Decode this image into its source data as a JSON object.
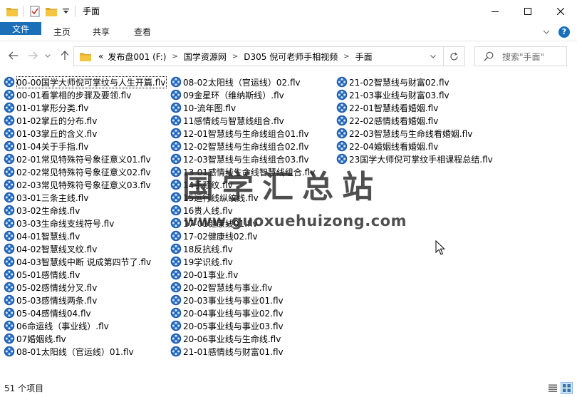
{
  "window": {
    "title": "手面",
    "minimize": "—",
    "maximize": "☐",
    "close": "✕"
  },
  "ribbon": {
    "tabs": [
      "文件",
      "主页",
      "共享",
      "查看"
    ]
  },
  "address": {
    "prefix": "«",
    "crumbs": [
      "发布盘001 (F:)",
      "国学资源网",
      "D305 倪可老师手相视频",
      "手面"
    ]
  },
  "search": {
    "placeholder": "搜索\"手面\""
  },
  "files": {
    "column1": [
      "00-00国学大师倪可掌纹与人生开篇.flv",
      "00-01看掌相的步骤及要领.flv",
      "01-01掌形分类.flv",
      "01-02掌丘的分布.flv",
      "01-03掌丘的含义.flv",
      "01-04关于手指.flv",
      "02-01常见特殊符号象征意义01.flv",
      "02-02常见特殊符号象征意义02.flv",
      "02-03常见特殊符号象征意义03.flv",
      "03-01三条主线.flv",
      "03-02生命线.flv",
      "03-03生命线支线符号.flv",
      "04-01智慧线.flv",
      "04-02智慧线叉纹.flv",
      "04-03智慧线中断 说成第四节了.flv",
      "05-01感情线.flv",
      "05-02感情线分叉.flv",
      "05-03感情线两条.flv",
      "05-04感情线04.flv",
      "06命运线（事业线）.flv",
      "07婚姻线.flv",
      "08-01太阳线（官运线）01.flv"
    ],
    "column2": [
      "08-02太阳线（官运线）02.flv",
      "09金星环（维纳斯线）.flv",
      "10-流年图.flv",
      "11感情线与智慧线组合.flv",
      "12-01智慧线与生命线组合01.flv",
      "12-02智慧线与生命线组合02.flv",
      "12-03智慧线与生命线组合03.flv",
      "13-01感情线生命线智慧线组合.flv",
      "14手颈纹.flv",
      "15运行线纵纹线.flv",
      "16贵人线.flv",
      "17-01健康线01.flv",
      "17-02健康线02.flv",
      "18反抗线.flv",
      "19学识线.flv",
      "20-01事业.flv",
      "20-02智慧线与事业.flv",
      "20-03事业线与事业01.flv",
      "20-04事业线与事业02.flv",
      "20-05事业线与事业03.flv",
      "20-06事业线与生命线.flv",
      "21-01感情线与财富01.flv"
    ],
    "column3": [
      "21-02智慧线与财富02.flv",
      "21-03事业线与财富03.flv",
      "22-01智慧线看婚姻.flv",
      "22-02感情线看婚姻.flv",
      "22-03智慧线与生命线看婚姻.flv",
      "22-04婚姻线看婚姻.flv",
      "23国学大师倪可掌纹手相课程总结.flv"
    ]
  },
  "watermark": {
    "title": "国学汇总站",
    "url": "www.guoxuehuizong.com"
  },
  "status": {
    "count": "51 个项目"
  },
  "colors": {
    "accent": "#1a6fb8",
    "folder": "#f5c542",
    "file_icon": "#1e5aa8"
  }
}
